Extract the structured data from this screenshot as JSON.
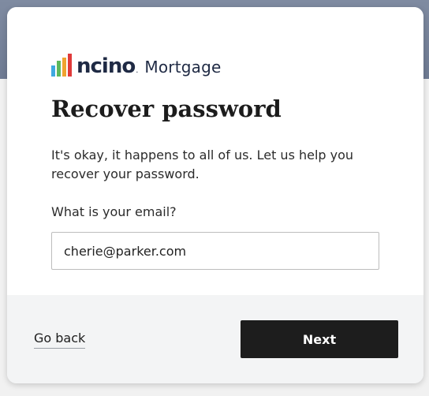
{
  "brand": {
    "wordmark": "ncino",
    "product": "Mortgage",
    "bar_colors": [
      "#3fa9e0",
      "#5cb85c",
      "#f0a330",
      "#e03a3a"
    ]
  },
  "page": {
    "title": "Recover password",
    "description": "It's okay, it happens to all of us. Let us help you recover your password."
  },
  "form": {
    "email_label": "What is your email?",
    "email_value": "cherie@parker.com"
  },
  "footer": {
    "back_label": "Go back",
    "next_label": "Next"
  },
  "colors": {
    "primary_button": "#1d1d1d",
    "footer_bg": "#f3f4f5",
    "header_bg": "#6f7b93"
  }
}
